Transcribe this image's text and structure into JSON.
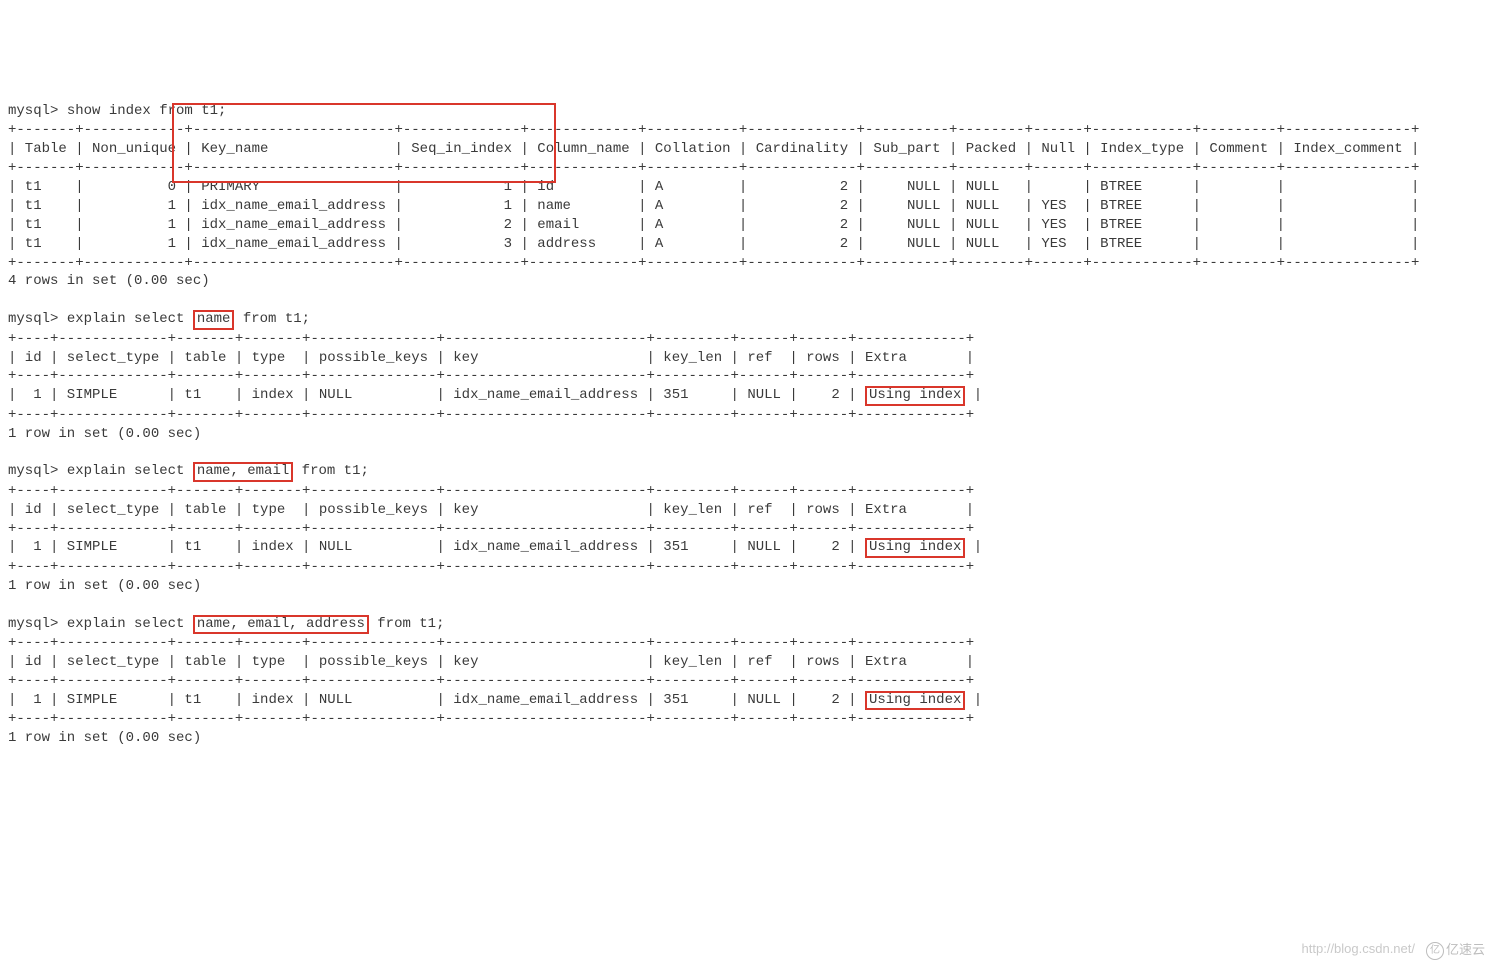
{
  "cmd1": {
    "prompt": "mysql> ",
    "query": "show index from t1;",
    "sep_top": "+-------+------------+------------------------+--------------+-------------+-----------+-------------+----------+--------+------+------------+---------+---------------+",
    "header": "| Table | Non_unique | Key_name               | Seq_in_index | Column_name | Collation | Cardinality | Sub_part | Packed | Null | Index_type | Comment | Index_comment |",
    "rows": [
      "| t1    |          0 | PRIMARY                |            1 | id          | A         |           2 |     NULL | NULL   |      | BTREE      |         |               |",
      "| t1    |          1 | idx_name_email_address |            1 | name        | A         |           2 |     NULL | NULL   | YES  | BTREE      |         |               |",
      "| t1    |          1 | idx_name_email_address |            2 | email       | A         |           2 |     NULL | NULL   | YES  | BTREE      |         |               |",
      "| t1    |          1 | idx_name_email_address |            3 | address     | A         |           2 |     NULL | NULL   | YES  | BTREE      |         |               |"
    ],
    "footer": "4 rows in set (0.00 sec)"
  },
  "cmd2": {
    "prompt": "mysql> ",
    "q_pre": "explain select ",
    "q_hl": "name",
    "q_post": " from t1;",
    "sep": "+----+-------------+-------+-------+---------------+------------------------+---------+------+------+-------------+",
    "header": "| id | select_type | table | type  | possible_keys | key                    | key_len | ref  | rows | Extra       |",
    "row_pre": "|  1 | SIMPLE      | t1    | index | NULL          | idx_name_email_address | 351     | NULL |    2 | ",
    "row_hl": "Using index",
    "row_post": " |",
    "footer": "1 row in set (0.00 sec)"
  },
  "cmd3": {
    "prompt": "mysql> ",
    "q_pre": "explain select ",
    "q_hl": "name, email",
    "q_post": " from t1;",
    "sep": "+----+-------------+-------+-------+---------------+------------------------+---------+------+------+-------------+",
    "header": "| id | select_type | table | type  | possible_keys | key                    | key_len | ref  | rows | Extra       |",
    "row_pre": "|  1 | SIMPLE      | t1    | index | NULL          | idx_name_email_address | 351     | NULL |    2 | ",
    "row_hl": "Using index",
    "row_post": " |",
    "footer": "1 row in set (0.00 sec)"
  },
  "cmd4": {
    "prompt": "mysql> ",
    "q_pre": "explain select ",
    "q_hl": "name, email, address",
    "q_post": " from t1;",
    "sep": "+----+-------------+-------+-------+---------------+------------------------+---------+------+------+-------------+",
    "header": "| id | select_type | table | type  | possible_keys | key                    | key_len | ref  | rows | Extra       |",
    "row_pre": "|  1 | SIMPLE      | t1    | index | NULL          | idx_name_email_address | 351     | NULL |    2 | ",
    "row_hl": "Using index",
    "row_post": " |",
    "footer": "1 row in set (0.00 sec)"
  },
  "watermark": "http://blog.csdn.net/",
  "logo": "亿速云"
}
